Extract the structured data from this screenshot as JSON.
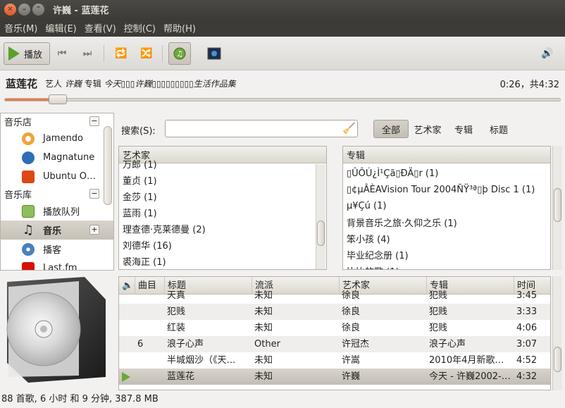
{
  "window": {
    "title": "许巍 - 蓝莲花"
  },
  "menu": [
    "音乐(M)",
    "编辑(E)",
    "查看(V)",
    "控制(C)",
    "帮助(H)"
  ],
  "toolbar": {
    "play_label": "播放"
  },
  "now_playing": {
    "title": "蓝莲花",
    "artist_label": "艺人",
    "artist": "许巍",
    "album_label": "专辑",
    "album": "今天▯▯▯许巍▯▯▯▯▯▯▯▯▯生活作品集",
    "time": "0:26，共4:32",
    "progress": 0.095
  },
  "sidebar": {
    "store_header": "音乐店",
    "store_items": [
      "Jamendo",
      "Magnatune",
      "Ubuntu O…"
    ],
    "library_header": "音乐库",
    "library_items": [
      "播放队列",
      "音乐",
      "播客",
      "Last.fm"
    ]
  },
  "search": {
    "label": "搜索(S):",
    "value": ""
  },
  "filters": [
    "全部",
    "艺术家",
    "专辑",
    "标题"
  ],
  "artist_pane": {
    "header": "艺术家",
    "rows": [
      "万郎 (1)",
      "董贞 (1)",
      "金莎 (1)",
      "蓝雨 (1)",
      "理查德·克莱德曼 (2)",
      "刘德华 (16)",
      "裘海正 (1)"
    ]
  },
  "album_pane": {
    "header": "专辑",
    "rows": [
      "▯ÛÔÚ¿Ì¹Çã▯ÐÄ▯r (1)",
      "▯¢µÂÈAVision Tour 2004ÑŸ³ª▯þ Disc 1 (1)",
      "µ¥Çú (1)",
      "背景音乐之旅·久仰之乐 (1)",
      "笨小孩 (4)",
      "毕业纪念册 (1)",
      "比比的歌 (1)"
    ]
  },
  "tracks": {
    "columns": [
      "曲目",
      "标题",
      "流派",
      "艺术家",
      "专辑",
      "时间"
    ],
    "rows": [
      {
        "num": "",
        "title": "天真",
        "genre": "未知",
        "artist": "徐良",
        "album": "犯贱",
        "time": "3:45"
      },
      {
        "num": "",
        "title": "犯贱",
        "genre": "未知",
        "artist": "徐良",
        "album": "犯贱",
        "time": "3:33"
      },
      {
        "num": "",
        "title": "红装",
        "genre": "未知",
        "artist": "徐良",
        "album": "犯贱",
        "time": "4:06"
      },
      {
        "num": "6",
        "title": "浪子心声",
        "genre": "Other",
        "artist": "许冠杰",
        "album": "浪子心声",
        "time": "3:07"
      },
      {
        "num": "",
        "title": "半城烟沙（《天…",
        "genre": "未知",
        "artist": "许嵩",
        "album": "2010年4月新歌…",
        "time": "4:52"
      },
      {
        "num": "",
        "title": "蓝莲花",
        "genre": "未知",
        "artist": "许巍",
        "album": "今天 - 许巍2002-…",
        "time": "4:32"
      }
    ]
  },
  "status": "88 首歌, 6 小时 和 9 分钟, 387.8 MB",
  "colors": {
    "accent": "#e77c4a",
    "play_green": "#5aa02c",
    "titlebar": "#3c3b37"
  }
}
